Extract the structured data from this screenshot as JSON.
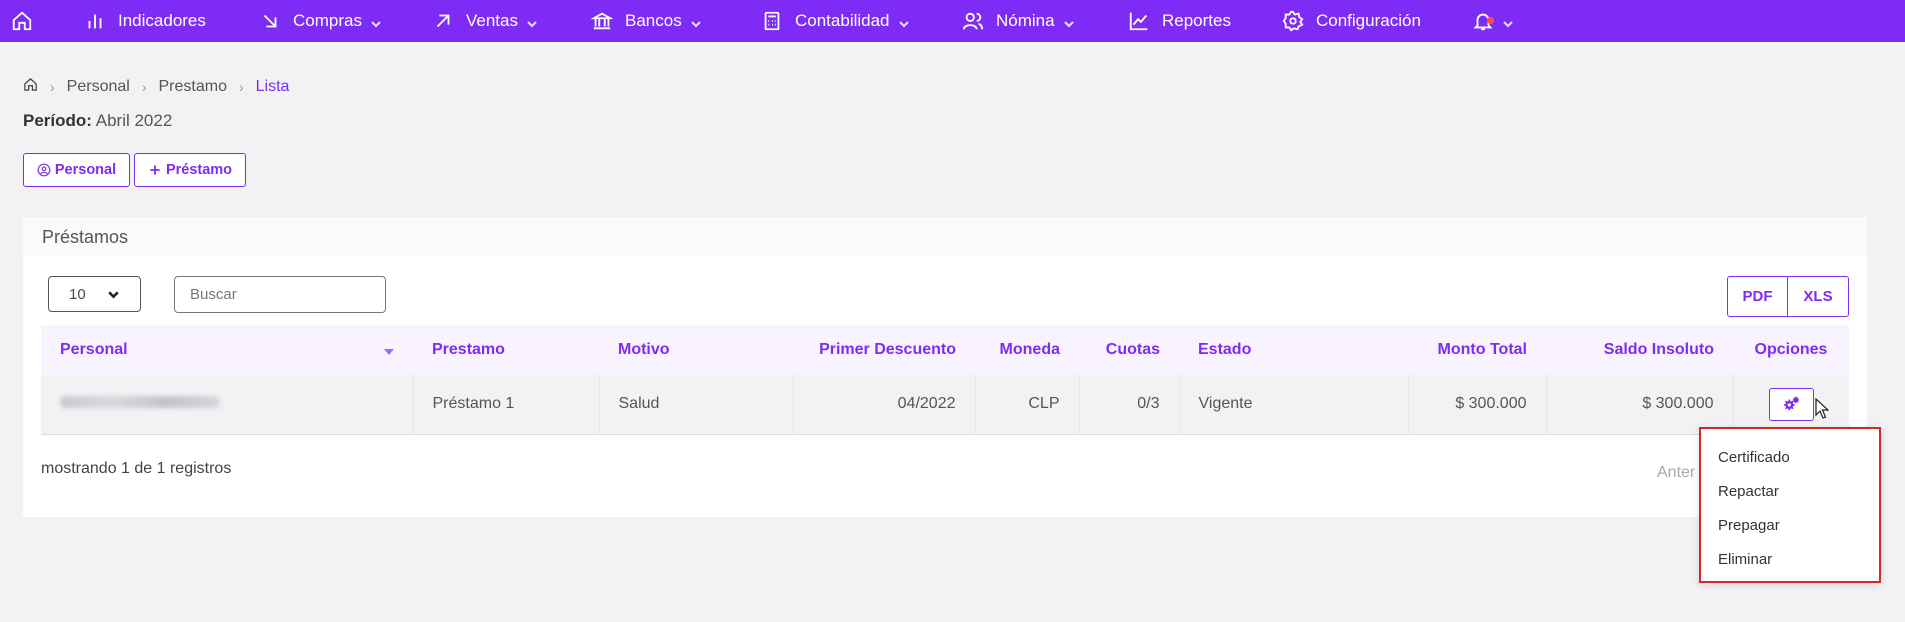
{
  "nav": {
    "items": [
      {
        "label": "Indicadores"
      },
      {
        "label": "Compras"
      },
      {
        "label": "Ventas"
      },
      {
        "label": "Bancos"
      },
      {
        "label": "Contabilidad"
      },
      {
        "label": "Nómina"
      },
      {
        "label": "Reportes"
      },
      {
        "label": "Configuración"
      }
    ]
  },
  "breadcrumb": {
    "items": [
      "Personal",
      "Prestamo",
      "Lista"
    ]
  },
  "periodo": {
    "label": "Período:",
    "value": "Abril 2022"
  },
  "actions": {
    "personal": "Personal",
    "prestamo": "Préstamo"
  },
  "card": {
    "title": "Préstamos",
    "page_length": "10",
    "search_placeholder": "Buscar",
    "export_pdf": "PDF",
    "export_xls": "XLS"
  },
  "table": {
    "headers": [
      "Personal",
      "Prestamo",
      "Motivo",
      "Primer Descuento",
      "Moneda",
      "Cuotas",
      "Estado",
      "Monto Total",
      "Saldo Insoluto",
      "Opciones"
    ],
    "rows": [
      {
        "prestamo": "Préstamo 1",
        "motivo": "Salud",
        "primer_descuento": "04/2022",
        "moneda": "CLP",
        "cuotas": "0/3",
        "estado": "Vigente",
        "monto_total": "$ 300.000",
        "saldo_insoluto": "$ 300.000"
      }
    ]
  },
  "footer": {
    "info": "mostrando 1 de 1 registros",
    "prev": "Anter"
  },
  "dropdown": {
    "items": [
      "Certificado",
      "Repactar",
      "Prepagar",
      "Eliminar"
    ]
  },
  "colors": {
    "brand": "#7e2cf5",
    "highlight_border": "#d42828"
  }
}
